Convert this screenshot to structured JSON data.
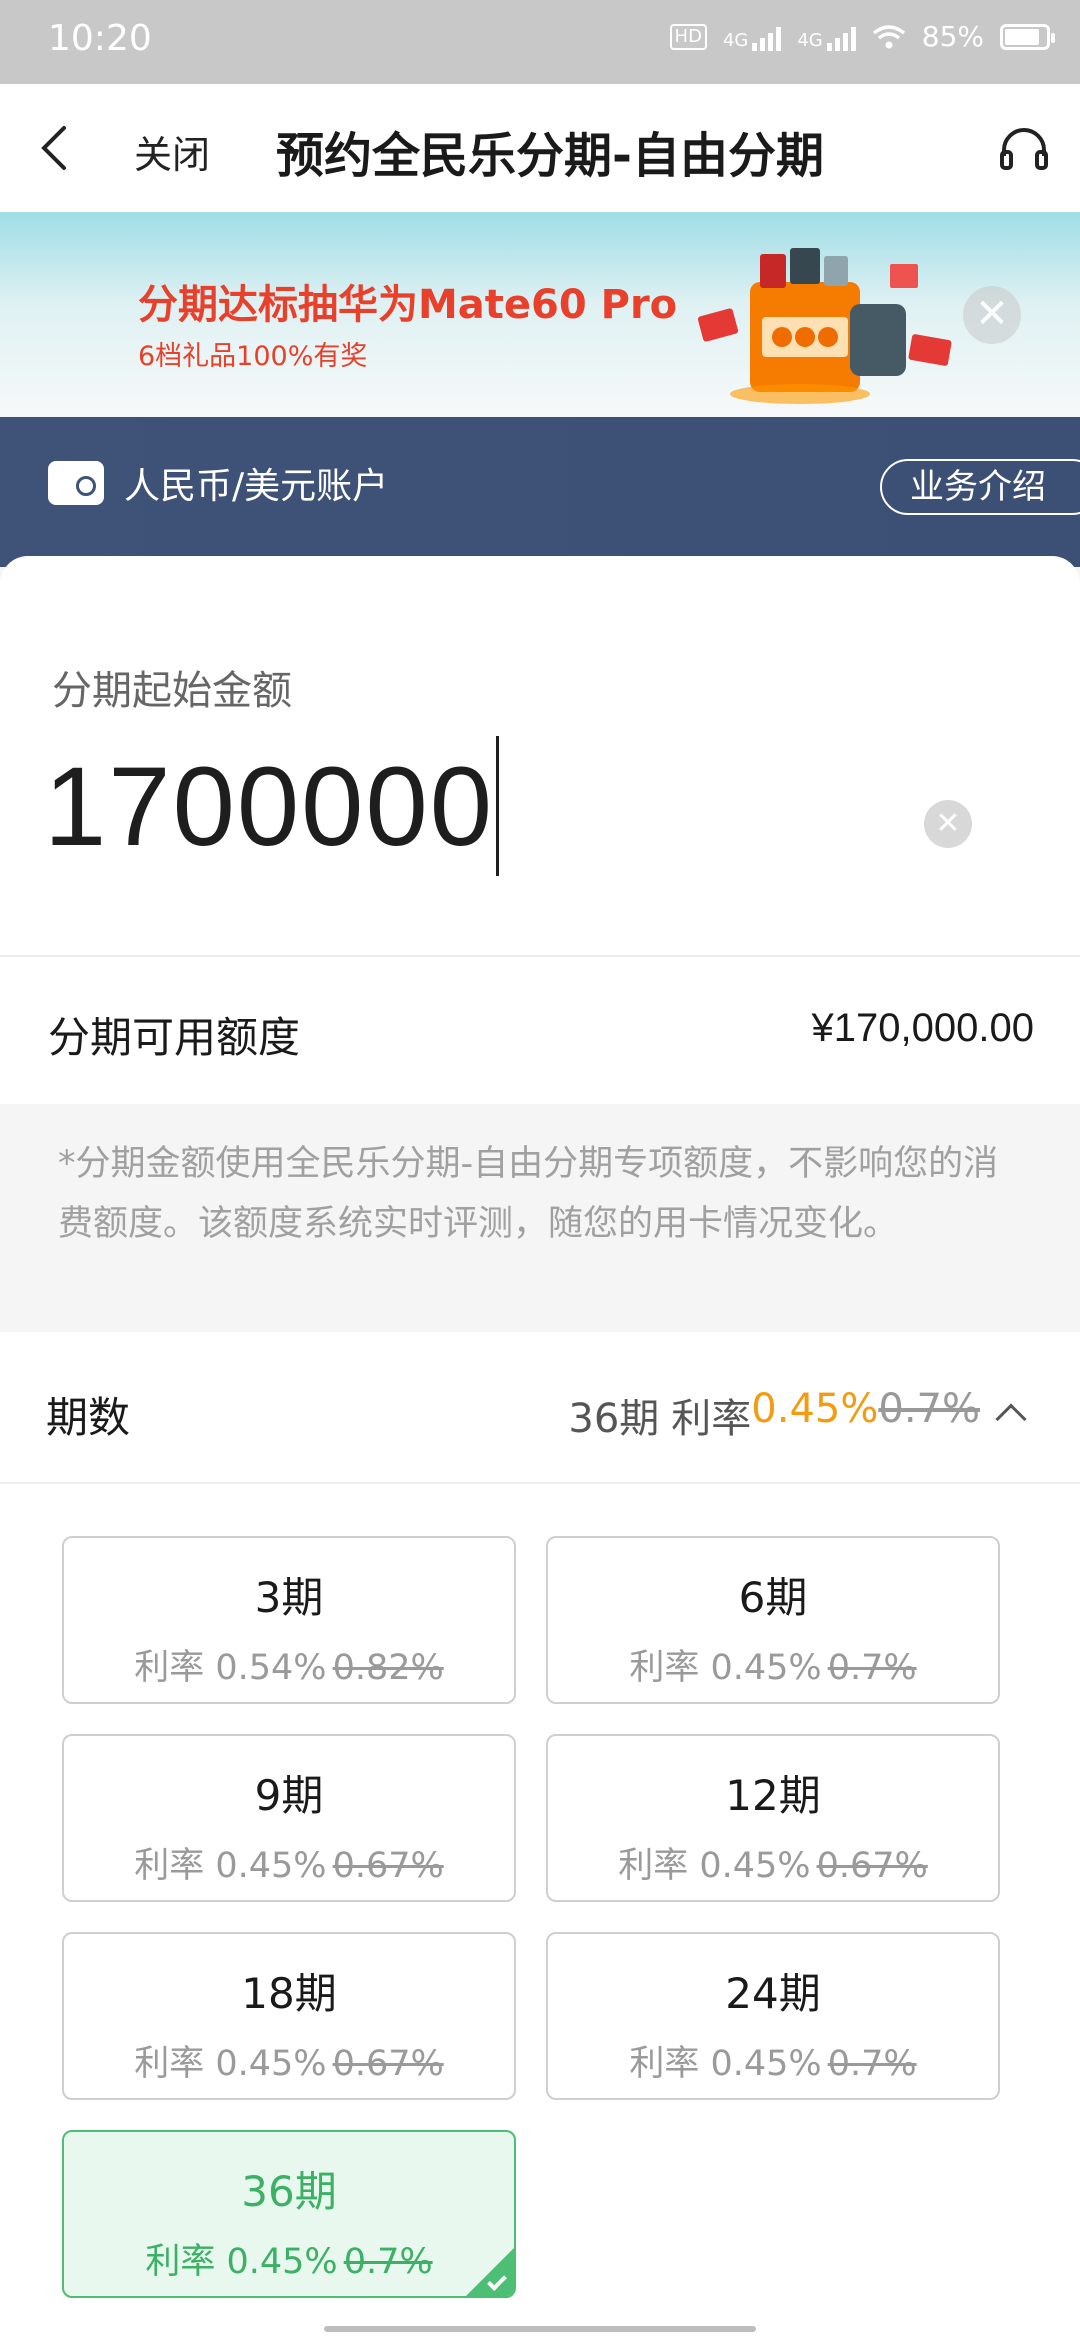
{
  "status_bar": {
    "time": "10:20",
    "hd": "HD",
    "net1": "4G",
    "net2": "4G",
    "battery": "85%",
    "battery_level": 0.85
  },
  "header": {
    "close_label": "关闭",
    "title": "预约全民乐分期-自由分期"
  },
  "banner": {
    "title": "分期达标抽华为Mate60 Pro",
    "subtitle": "6档礼品100%有奖"
  },
  "account": {
    "label": "人民币/美元账户",
    "intro_button": "业务介绍"
  },
  "amount": {
    "label": "分期起始金额",
    "value": "1700000"
  },
  "limit": {
    "label": "分期可用额度",
    "value": "¥170,000.00"
  },
  "note": "*分期金额使用全民乐分期-自由分期专项额度，不影响您的消费额度。该额度系统实时评测，随您的用卡情况变化。",
  "term": {
    "label": "期数",
    "selected_term": "36期",
    "rate_prefix": "利率",
    "rate": "0.45%",
    "old_rate": "0.7%"
  },
  "options": [
    {
      "term": "3期",
      "rate": "利率 0.54%",
      "old": "0.82%",
      "selected": false
    },
    {
      "term": "6期",
      "rate": "利率 0.45%",
      "old": "0.7%",
      "selected": false
    },
    {
      "term": "9期",
      "rate": "利率 0.45%",
      "old": "0.67%",
      "selected": false
    },
    {
      "term": "12期",
      "rate": "利率 0.45%",
      "old": "0.67%",
      "selected": false
    },
    {
      "term": "18期",
      "rate": "利率 0.45%",
      "old": "0.67%",
      "selected": false
    },
    {
      "term": "24期",
      "rate": "利率 0.45%",
      "old": "0.7%",
      "selected": false
    },
    {
      "term": "36期",
      "rate": "利率 0.45%",
      "old": "0.7%",
      "selected": true
    }
  ],
  "colors": {
    "accent_orange": "#f39c12",
    "selected_green": "#3cb065",
    "banner_red": "#e8402a",
    "account_bar": "#3f5378"
  }
}
